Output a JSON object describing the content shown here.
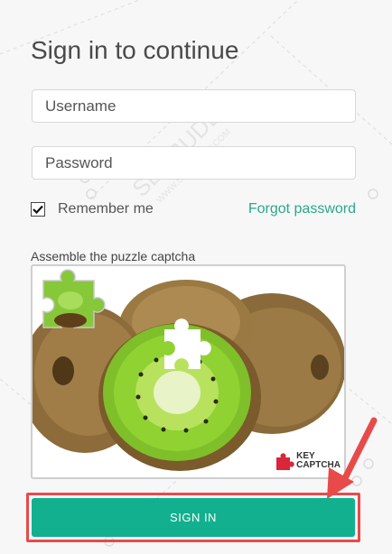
{
  "page": {
    "title": "Sign in to continue"
  },
  "form": {
    "username_placeholder": "Username",
    "username_value": "",
    "password_placeholder": "Password",
    "password_value": "",
    "remember_label": "Remember me",
    "remember_checked": true,
    "forgot_label": "Forgot password"
  },
  "captcha": {
    "label": "Assemble the puzzle captcha",
    "image": "kiwi-fruit-puzzle",
    "brand_line1": "KEY",
    "brand_line2": "CAPTCHA"
  },
  "actions": {
    "signin_label": "SIGN IN"
  },
  "annotation": {
    "highlight_color": "#e84a4a",
    "arrow": "red-arrow-pointing-to-signin"
  },
  "watermark": {
    "text": "SEOBUDDY",
    "url_text": "WWW.SEOBUDDY.COM"
  },
  "colors": {
    "accent": "#12b08e",
    "link": "#2aa98b"
  }
}
